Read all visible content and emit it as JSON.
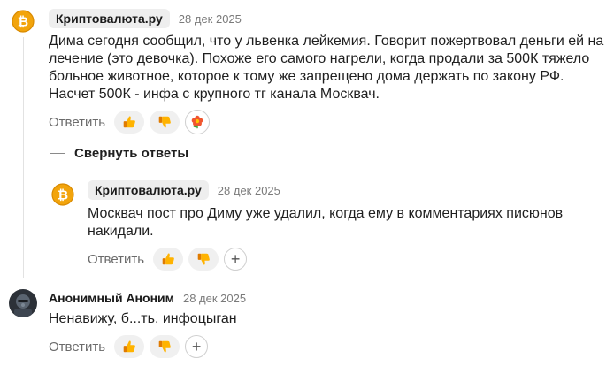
{
  "comments": [
    {
      "author": "Криптовалюта.ру",
      "date": "28 дек 2025",
      "text": "Дима сегодня сообщил, что у львенка лейкемия. Говорит пожертвовал деньги ей на лечение (это девочка). Похоже его самого нагрели, когда продали за 500К тяжело больное животное, которое к тому же запрещено дома держать по закону РФ. Насчет 500К - инфа с крупного тг канала Москвач.",
      "reply_label": "Ответить",
      "avatar_icon": "bitcoin-icon"
    },
    {
      "author": "Криптовалюта.ру",
      "date": "28 дек 2025",
      "text": "Москвач пост про Диму уже удалил, когда ему в комментариях писюнов накидали.",
      "reply_label": "Ответить",
      "avatar_icon": "bitcoin-icon"
    },
    {
      "author": "Анонимный Аноним",
      "date": "28 дек 2025",
      "text": "Ненавижу, б...ть, инфоцыган",
      "reply_label": "Ответить",
      "avatar_icon": "user-photo"
    }
  ],
  "collapse_label": "Свернуть ответы",
  "plus_symbol": "+",
  "colors": {
    "accent_coin": "#f7a600",
    "react_bg": "#f0f0f0",
    "chip_bg": "#eeeeee",
    "muted_text": "#7a7a7a"
  }
}
